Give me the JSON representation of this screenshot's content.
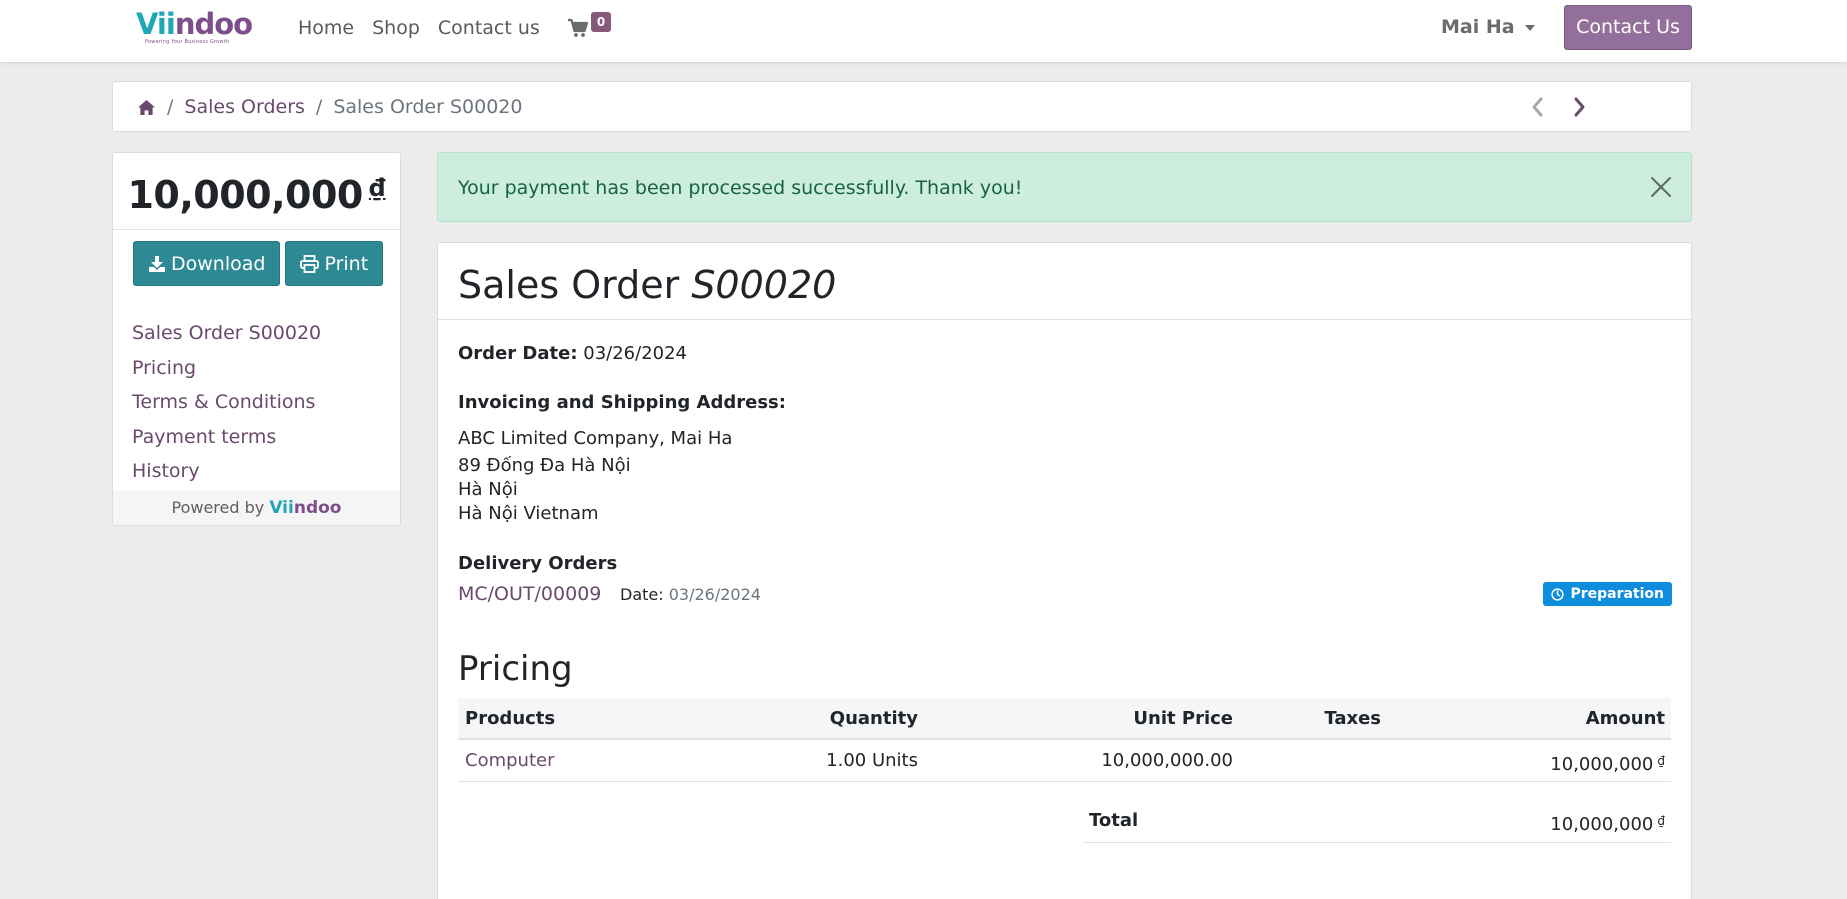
{
  "header": {
    "logo": {
      "word_a": "Vii",
      "word_b": "ndoo",
      "tagline": "Powering Your Business Growth"
    },
    "nav": [
      "Home",
      "Shop",
      "Contact us"
    ],
    "cart_count": "0",
    "user_name": "Mai Ha",
    "contact_button": "Contact Us",
    "accent_color": "#875a7b"
  },
  "breadcrumb": {
    "items": [
      "Sales Orders",
      "Sales Order S00020"
    ]
  },
  "sidebar": {
    "total_amount": "10,000,000",
    "currency": "₫",
    "download_label": "Download",
    "print_label": "Print",
    "toc": [
      "Sales Order S00020",
      "Pricing",
      "Terms & Conditions",
      "Payment terms",
      "History"
    ],
    "powered_by": "Powered by",
    "powered_brand_a": "Vii",
    "powered_brand_b": "ndoo"
  },
  "alert": {
    "message": "Your payment has been processed successfully. Thank you!"
  },
  "order": {
    "title_prefix": "Sales Order",
    "number": "S00020",
    "order_date_label": "Order Date:",
    "order_date": "03/26/2024",
    "address_label": "Invoicing and Shipping Address:",
    "address_lines": [
      "ABC Limited Company, Mai Ha",
      "89 Đống Đa Hà Nội",
      "Hà Nội",
      "Hà Nội Vietnam"
    ],
    "delivery_label": "Delivery Orders",
    "delivery_ref": "MC/OUT/00009",
    "delivery_date_label": "Date:",
    "delivery_date": "03/26/2024",
    "delivery_status": "Preparation"
  },
  "pricing": {
    "heading": "Pricing",
    "columns": [
      "Products",
      "Quantity",
      "Unit Price",
      "Taxes",
      "Amount"
    ],
    "rows": [
      {
        "product": "Computer",
        "quantity": "1.00 Units",
        "unit_price": "10,000,000.00",
        "taxes": "",
        "amount": "10,000,000",
        "currency": "₫"
      }
    ],
    "total_label": "Total",
    "total_amount": "10,000,000",
    "total_currency": "₫"
  }
}
